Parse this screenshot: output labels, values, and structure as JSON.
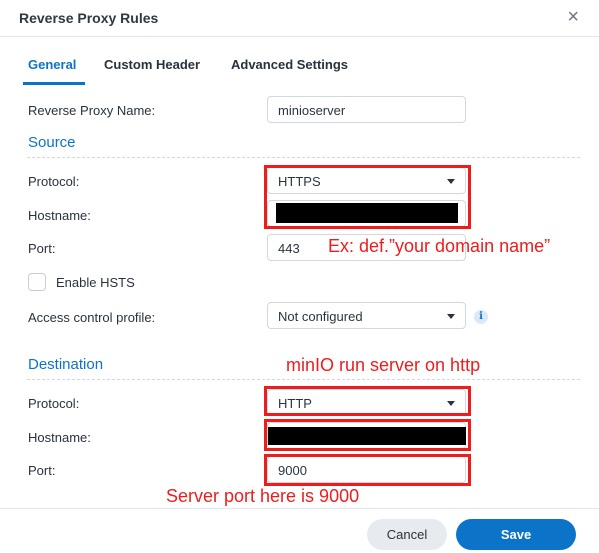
{
  "dialog": {
    "title": "Reverse Proxy Rules",
    "close_glyph": "×"
  },
  "tabs": [
    {
      "label": "General",
      "active": true
    },
    {
      "label": "Custom Header",
      "active": false
    },
    {
      "label": "Advanced Settings",
      "active": false
    }
  ],
  "general": {
    "name_label": "Reverse Proxy Name:",
    "name_value": "minioserver"
  },
  "source": {
    "title": "Source",
    "protocol_label": "Protocol:",
    "protocol_value": "HTTPS",
    "hostname_label": "Hostname:",
    "port_label": "Port:",
    "port_value": "443",
    "hsts_label": "Enable HSTS",
    "hsts_checked": false,
    "acp_label": "Access control profile:",
    "acp_value": "Not configured"
  },
  "destination": {
    "title": "Destination",
    "protocol_label": "Protocol:",
    "protocol_value": "HTTP",
    "hostname_label": "Hostname:",
    "port_label": "Port:",
    "port_value": "9000"
  },
  "annotations": {
    "domain_hint": "Ex: def.”your domain name”",
    "minio_note": "minIO run server on http",
    "port_note": "Server port here is 9000",
    "color": "#ee1c1c"
  },
  "footer": {
    "cancel_label": "Cancel",
    "save_label": "Save"
  },
  "colors": {
    "accent": "#0c74c8",
    "annotation": "#ee1c1c"
  }
}
